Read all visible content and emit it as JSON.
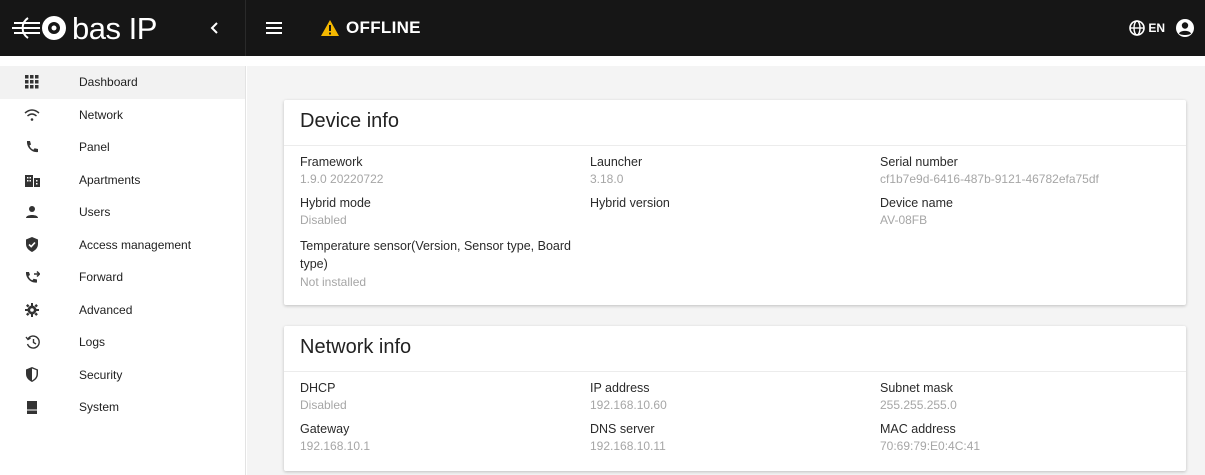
{
  "header": {
    "logo_text": "bas IP",
    "status_text": "OFFLINE",
    "language": "EN"
  },
  "sidebar": {
    "items": [
      {
        "label": "Dashboard",
        "icon": "grid-icon"
      },
      {
        "label": "Network",
        "icon": "wifi-icon"
      },
      {
        "label": "Panel",
        "icon": "phone-icon"
      },
      {
        "label": "Apartments",
        "icon": "building-icon"
      },
      {
        "label": "Users",
        "icon": "person-icon"
      },
      {
        "label": "Access management",
        "icon": "shield-check-icon"
      },
      {
        "label": "Forward",
        "icon": "phone-forward-icon"
      },
      {
        "label": "Advanced",
        "icon": "gear-icon"
      },
      {
        "label": "Logs",
        "icon": "history-icon"
      },
      {
        "label": "Security",
        "icon": "shield-icon"
      },
      {
        "label": "System",
        "icon": "sd-card-icon"
      }
    ]
  },
  "device_info": {
    "title": "Device info",
    "framework": {
      "label": "Framework",
      "value": "1.9.0 20220722"
    },
    "launcher": {
      "label": "Launcher",
      "value": "3.18.0"
    },
    "serial": {
      "label": "Serial number",
      "value": "cf1b7e9d-6416-487b-9121-46782efa75df"
    },
    "hybrid_mode": {
      "label": "Hybrid mode",
      "value": "Disabled"
    },
    "hybrid_version": {
      "label": "Hybrid version",
      "value": ""
    },
    "device_name": {
      "label": "Device name",
      "value": "AV-08FB"
    },
    "temp_sensor": {
      "label": "Temperature sensor(Version, Sensor type, Board type)",
      "value": "Not installed"
    }
  },
  "network_info": {
    "title": "Network info",
    "dhcp": {
      "label": "DHCP",
      "value": "Disabled"
    },
    "ip": {
      "label": "IP address",
      "value": "192.168.10.60"
    },
    "subnet": {
      "label": "Subnet mask",
      "value": "255.255.255.0"
    },
    "gateway": {
      "label": "Gateway",
      "value": "192.168.10.1"
    },
    "dns": {
      "label": "DNS server",
      "value": "192.168.10.11"
    },
    "mac": {
      "label": "MAC address",
      "value": "70:69:79:E0:4C:41"
    }
  },
  "colors": {
    "topbar": "#161616",
    "warning": "#f5b800",
    "value_text": "#a6a6a6"
  }
}
